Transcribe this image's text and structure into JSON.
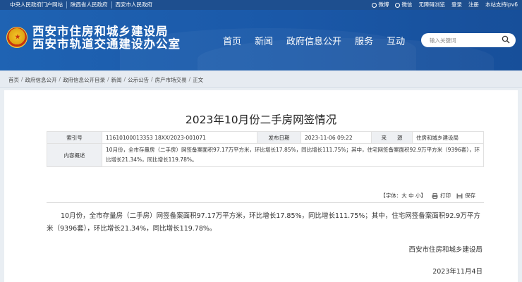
{
  "topbar": {
    "links": [
      "中央人民政府门户网站",
      "陕西省人民政府",
      "西安市人民政府"
    ],
    "right": {
      "weibo": "微博",
      "wechat": "微信",
      "accessibility": "无障碍浏览",
      "login": "登录",
      "register": "注册",
      "ipv6": "本站支持ipv6"
    }
  },
  "header": {
    "title_line1": "西安市住房和城乡建设局",
    "title_line2": "西安市轨道交通建设办公室",
    "nav": [
      "首页",
      "新闻",
      "政府信息公开",
      "服务",
      "互动"
    ],
    "search_placeholder": "输入关键词"
  },
  "breadcrumb": [
    "首页",
    "政府信息公开",
    "政府信息公开目录",
    "新闻",
    "公示公告",
    "房产市场交易",
    "正文"
  ],
  "article": {
    "title": "2023年10月份二手房网签情况",
    "meta": {
      "index_label": "索引号",
      "index_value": "11610100013353 18XX/2023-001071",
      "date_label": "发布日期",
      "date_value": "2023-11-06 09:22",
      "source_label": "来　　源",
      "source_value": "住房和城乡建设局",
      "summary_label": "内容概述",
      "summary_value": "10月份，全市存量房（二手房）网签备案面积97.17万平方米，环比增长17.85%，同比增长111.75%；其中，住宅网签备案面积92.9万平方米（9396套），环比增长21.34%，同比增长119.78%。"
    },
    "tools": {
      "font_size": "【字体：大 中 小】",
      "print": "打印",
      "save": "保存"
    },
    "body": "10月份，全市存量房（二手房）网签备案面积97.17万平方米，环比增长17.85%，同比增长111.75%；其中，住宅网签备案面积92.9万平方米（9396套），环比增长21.34%，同比增长119.78%。",
    "signature": "西安市住房和城乡建设局",
    "date": "2023年11月4日"
  }
}
